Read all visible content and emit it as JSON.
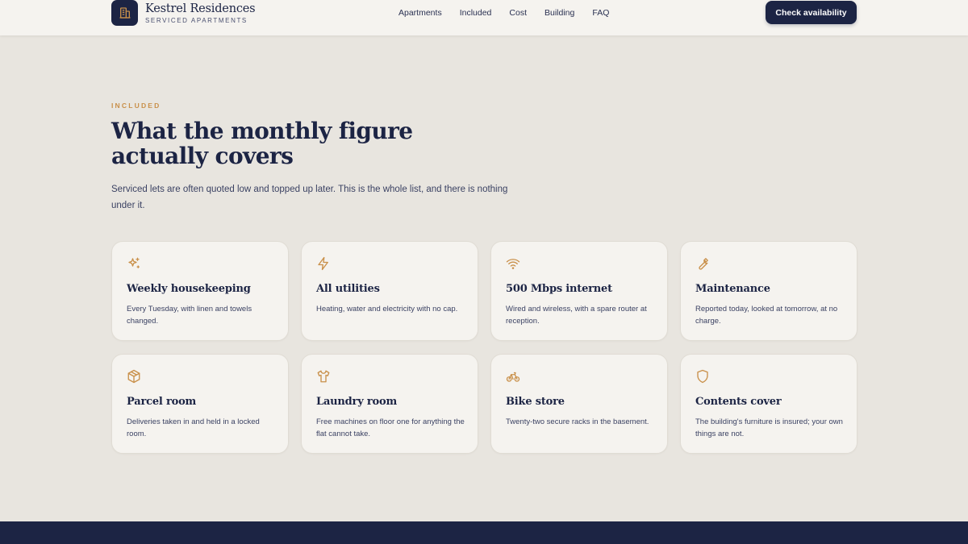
{
  "brand": {
    "name": "Kestrel Residences",
    "tagline": "SERVICED APARTMENTS"
  },
  "nav": {
    "items": [
      "Apartments",
      "Included",
      "Cost",
      "Building",
      "FAQ"
    ],
    "cta_label": "Check availability"
  },
  "intro": {
    "eyebrow": "INCLUDED",
    "title": "What the monthly figure actually covers",
    "lede": "Serviced lets are often quoted low and topped up later. This is the whole list, and there is nothing under it."
  },
  "cards": [
    {
      "icon": "sparkles-icon",
      "title": "Weekly housekeeping",
      "desc": "Every Tuesday, with linen and towels changed."
    },
    {
      "icon": "lightning-icon",
      "title": "All utilities",
      "desc": "Heating, water and electricity with no cap."
    },
    {
      "icon": "wifi-icon",
      "title": "500 Mbps internet",
      "desc": "Wired and wireless, with a spare router at reception."
    },
    {
      "icon": "wrench-icon",
      "title": "Maintenance",
      "desc": "Reported today, looked at tomorrow, at no charge."
    },
    {
      "icon": "package-icon",
      "title": "Parcel room",
      "desc": "Deliveries taken in and held in a locked room."
    },
    {
      "icon": "shirt-icon",
      "title": "Laundry room",
      "desc": "Free machines on floor one for anything the flat cannot take."
    },
    {
      "icon": "bike-icon",
      "title": "Bike store",
      "desc": "Twenty-two secure racks in the basement."
    },
    {
      "icon": "shield-icon",
      "title": "Contents cover",
      "desc": "The building's furniture is insured; your own things are not."
    }
  ],
  "colors": {
    "navy": "#1c2444",
    "accent": "#c9904a",
    "background": "#e8e5df",
    "card": "#f5f3ef"
  }
}
